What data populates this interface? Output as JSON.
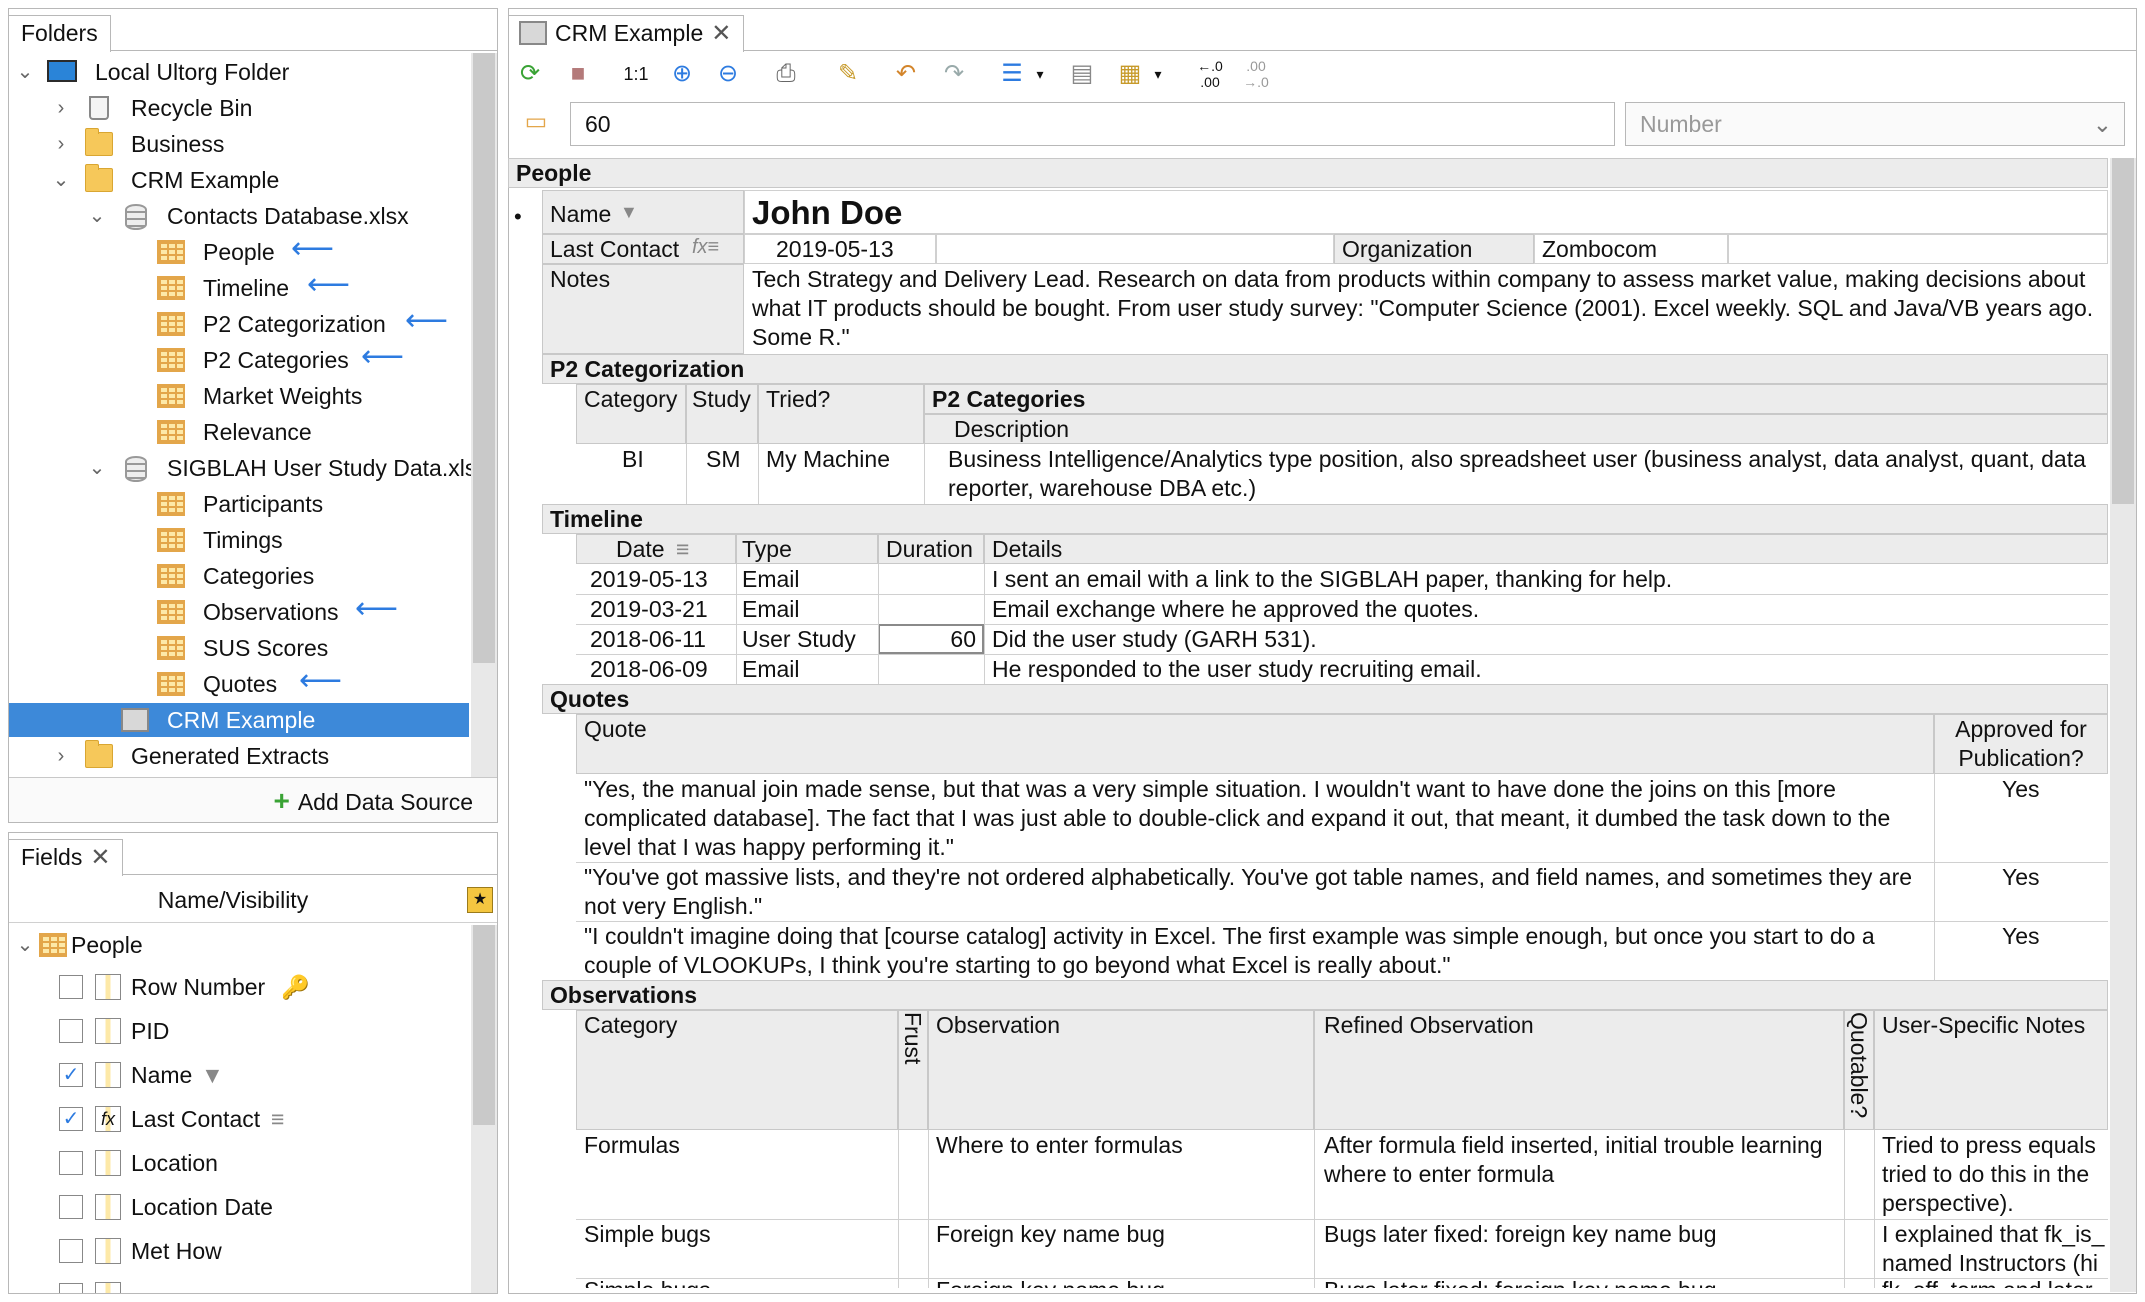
{
  "folders": {
    "tab_label": "Folders",
    "items": [
      {
        "label": "Local Ultorg Folder"
      },
      {
        "label": "Recycle Bin"
      },
      {
        "label": "Business"
      },
      {
        "label": "CRM Example"
      },
      {
        "label": "Contacts Database.xlsx"
      },
      {
        "label": "People"
      },
      {
        "label": "Timeline"
      },
      {
        "label": "P2 Categorization"
      },
      {
        "label": "P2 Categories"
      },
      {
        "label": "Market Weights"
      },
      {
        "label": "Relevance"
      },
      {
        "label": "SIGBLAH User Study Data.xls"
      },
      {
        "label": "Participants"
      },
      {
        "label": "Timings"
      },
      {
        "label": "Categories"
      },
      {
        "label": "Observations"
      },
      {
        "label": "SUS Scores"
      },
      {
        "label": "Quotes"
      },
      {
        "label": "CRM Example"
      },
      {
        "label": "Generated Extracts"
      }
    ],
    "add_source": "Add Data Source"
  },
  "fields": {
    "tab_label": "Fields",
    "column_header": "Name/Visibility",
    "root": "People",
    "items": [
      {
        "label": "Row Number",
        "checked": false
      },
      {
        "label": "PID",
        "checked": false
      },
      {
        "label": "Name",
        "checked": true
      },
      {
        "label": "Last Contact",
        "checked": true
      },
      {
        "label": "Location",
        "checked": false
      },
      {
        "label": "Location Date",
        "checked": false
      },
      {
        "label": "Met How",
        "checked": false
      }
    ]
  },
  "editor": {
    "tab_label": "CRM Example",
    "zoom_label": "1:1",
    "formula_value": "60",
    "type_select": "Number",
    "dec_more": "←.0\n.00",
    "dec_less": ".00\n→.0"
  },
  "record": {
    "section": "People",
    "name_label": "Name",
    "name_value": "John Doe",
    "last_contact_label": "Last Contact",
    "last_contact_value": "2019-05-13",
    "org_label": "Organization",
    "org_value": "Zombocom",
    "notes_label": "Notes",
    "notes_value": "Tech Strategy and Delivery Lead. Research on data from products within company to assess market value, making decisions about what IT products should be bought. From user study survey: \"Computer Science (2001). Excel weekly. SQL and Java/VB years ago. Some R.\""
  },
  "p2": {
    "section": "P2 Categorization",
    "col_category": "Category",
    "col_study": "Study",
    "col_tried": "Tried?",
    "sub_section": "P2 Categories",
    "col_description": "Description",
    "row": {
      "category": "BI",
      "study": "SM",
      "tried": "My Machine",
      "description": "Business Intelligence/Analytics type position, also spreadsheet user (business analyst, data analyst, quant, data reporter, warehouse DBA etc.)"
    }
  },
  "timeline": {
    "section": "Timeline",
    "col_date": "Date",
    "col_type": "Type",
    "col_duration": "Duration",
    "col_details": "Details",
    "rows": [
      {
        "date": "2019-05-13",
        "type": "Email",
        "duration": "",
        "details": "I sent an email with a link to the SIGBLAH paper, thanking for help."
      },
      {
        "date": "2019-03-21",
        "type": "Email",
        "duration": "",
        "details": "Email exchange where he approved the quotes."
      },
      {
        "date": "2018-06-11",
        "type": "User Study",
        "duration": "60",
        "details": "Did the user study (GARH 531)."
      },
      {
        "date": "2018-06-09",
        "type": "Email",
        "duration": "",
        "details": "He responded to the user study recruiting email."
      }
    ]
  },
  "quotes": {
    "section": "Quotes",
    "col_quote": "Quote",
    "col_approved": "Approved for Publication?",
    "rows": [
      {
        "quote": "\"Yes, the manual join made sense, but that was a very simple situation. I wouldn't want to have done the joins on this [more complicated database]. The fact that I was just able to double-click and expand it out, that meant, it dumbed the task down to the level that I was happy performing it.\"",
        "approved": "Yes"
      },
      {
        "quote": "\"You've got massive lists, and they're not ordered alphabetically. You've got table names, and field names, and sometimes they are not very English.\"",
        "approved": "Yes"
      },
      {
        "quote": "\"I couldn't imagine doing that [course catalog] activity in Excel. The first example was simple enough, but once you start to do a couple of VLOOKUPs, I think you're starting to go beyond what Excel is really about.\"",
        "approved": "Yes"
      }
    ]
  },
  "observations": {
    "section": "Observations",
    "col_category": "Category",
    "col_frust": "Frust",
    "col_observation": "Observation",
    "col_refined": "Refined Observation",
    "col_quotable": "Quotable?",
    "col_notes": "User-Specific Notes",
    "rows": [
      {
        "category": "Formulas",
        "observation": "Where to enter formulas",
        "refined": "After formula field inserted, initial trouble learning where to enter formula",
        "notes": "Tried to press equals tried to do this in the perspective)."
      },
      {
        "category": "Simple bugs",
        "observation": "Foreign key name bug",
        "refined": "Bugs later fixed: foreign key name bug",
        "notes": "I explained that fk_is_ named Instructors (hi"
      },
      {
        "category": "Simple bugs",
        "observation": "Foreign key name bug",
        "refined": "Bugs later fixed: foreign key name bug",
        "notes": "fk_off_term and later"
      }
    ]
  }
}
